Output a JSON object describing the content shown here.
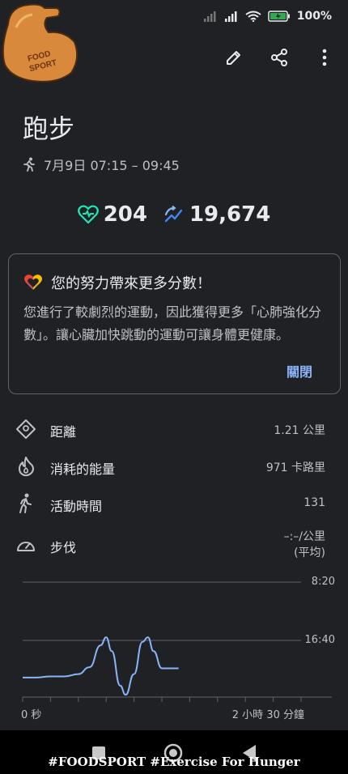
{
  "status": {
    "battery": "100%"
  },
  "logo": {
    "text_line1": "FOOD",
    "text_line2": "SPORT"
  },
  "header": {
    "title": "跑步",
    "date_range": "7月9日 07:15 – 09:45"
  },
  "metrics": {
    "heart_points": "204",
    "steps": "19,674"
  },
  "card": {
    "title": "您的努力帶來更多分數！",
    "body": "您進行了較劇烈的運動，因此獲得更多「心肺強化分數」。讓心臟加快跳動的運動可讓身體更健康。",
    "close_label": "關閉"
  },
  "stats": [
    {
      "icon": "distance-icon",
      "label": "距離",
      "value": "1.21 公里"
    },
    {
      "icon": "calories-icon",
      "label": "消耗的能量",
      "value": "971 卡路里"
    },
    {
      "icon": "walking-icon",
      "label": "活動時間",
      "value": "131"
    },
    {
      "icon": "pace-icon",
      "label": "步伐",
      "value": "–:–/公里",
      "value_sub": "(平均)"
    }
  ],
  "chart_data": {
    "type": "line",
    "y_tick_labels": [
      "8:20",
      "16:40"
    ],
    "x_tick_labels": [
      "0 秒",
      "2 小時 30 分鐘"
    ],
    "series": [
      {
        "values": [
          [
            0.0,
            0.83
          ],
          [
            0.05,
            0.83
          ],
          [
            0.1,
            0.82
          ],
          [
            0.15,
            0.82
          ],
          [
            0.2,
            0.8
          ],
          [
            0.24,
            0.74
          ],
          [
            0.28,
            0.55
          ],
          [
            0.3,
            0.48
          ],
          [
            0.32,
            0.6
          ],
          [
            0.35,
            0.9
          ],
          [
            0.37,
            0.98
          ],
          [
            0.4,
            0.8
          ],
          [
            0.43,
            0.52
          ],
          [
            0.45,
            0.48
          ],
          [
            0.47,
            0.6
          ],
          [
            0.5,
            0.75
          ],
          [
            0.53,
            0.75
          ],
          [
            0.56,
            0.75
          ]
        ]
      }
    ]
  },
  "caption": "#FOODSPORT #Exercise For Hunger"
}
